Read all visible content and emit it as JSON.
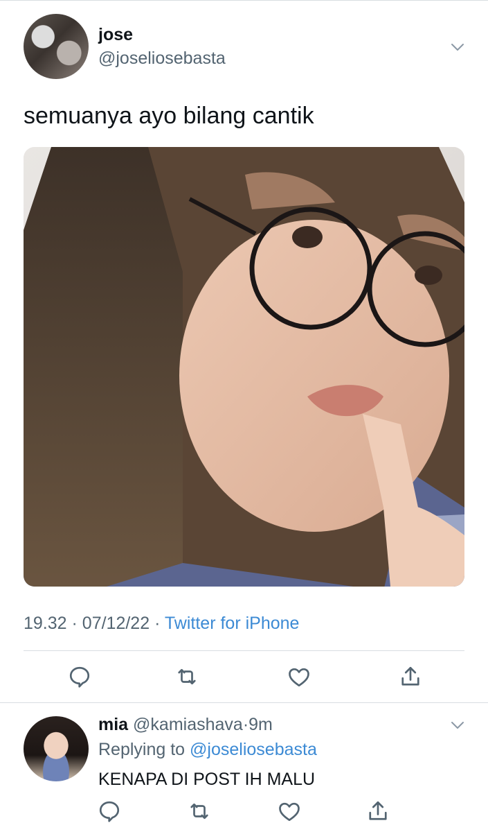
{
  "tweet": {
    "author_name": "jose",
    "author_handle": "@joseliosebasta",
    "text": "semuanya ayo bilang cantik",
    "time": "19.32",
    "date": "07/12/22",
    "source": "Twitter for iPhone",
    "separator": "·"
  },
  "actions": [
    "reply-icon",
    "retweet-icon",
    "like-icon",
    "share-icon"
  ],
  "reply": {
    "author_name": "mia",
    "author_handle": "@kamiashava",
    "separator": "·",
    "age": "9m",
    "replying_label": "Replying to",
    "replying_to": "@joseliosebasta",
    "text": "KENAPA DI POST IH MALU"
  },
  "colors": {
    "text": "#0f1419",
    "secondary": "#536471",
    "link": "#3c8ad4",
    "divider": "#d8dde1"
  }
}
